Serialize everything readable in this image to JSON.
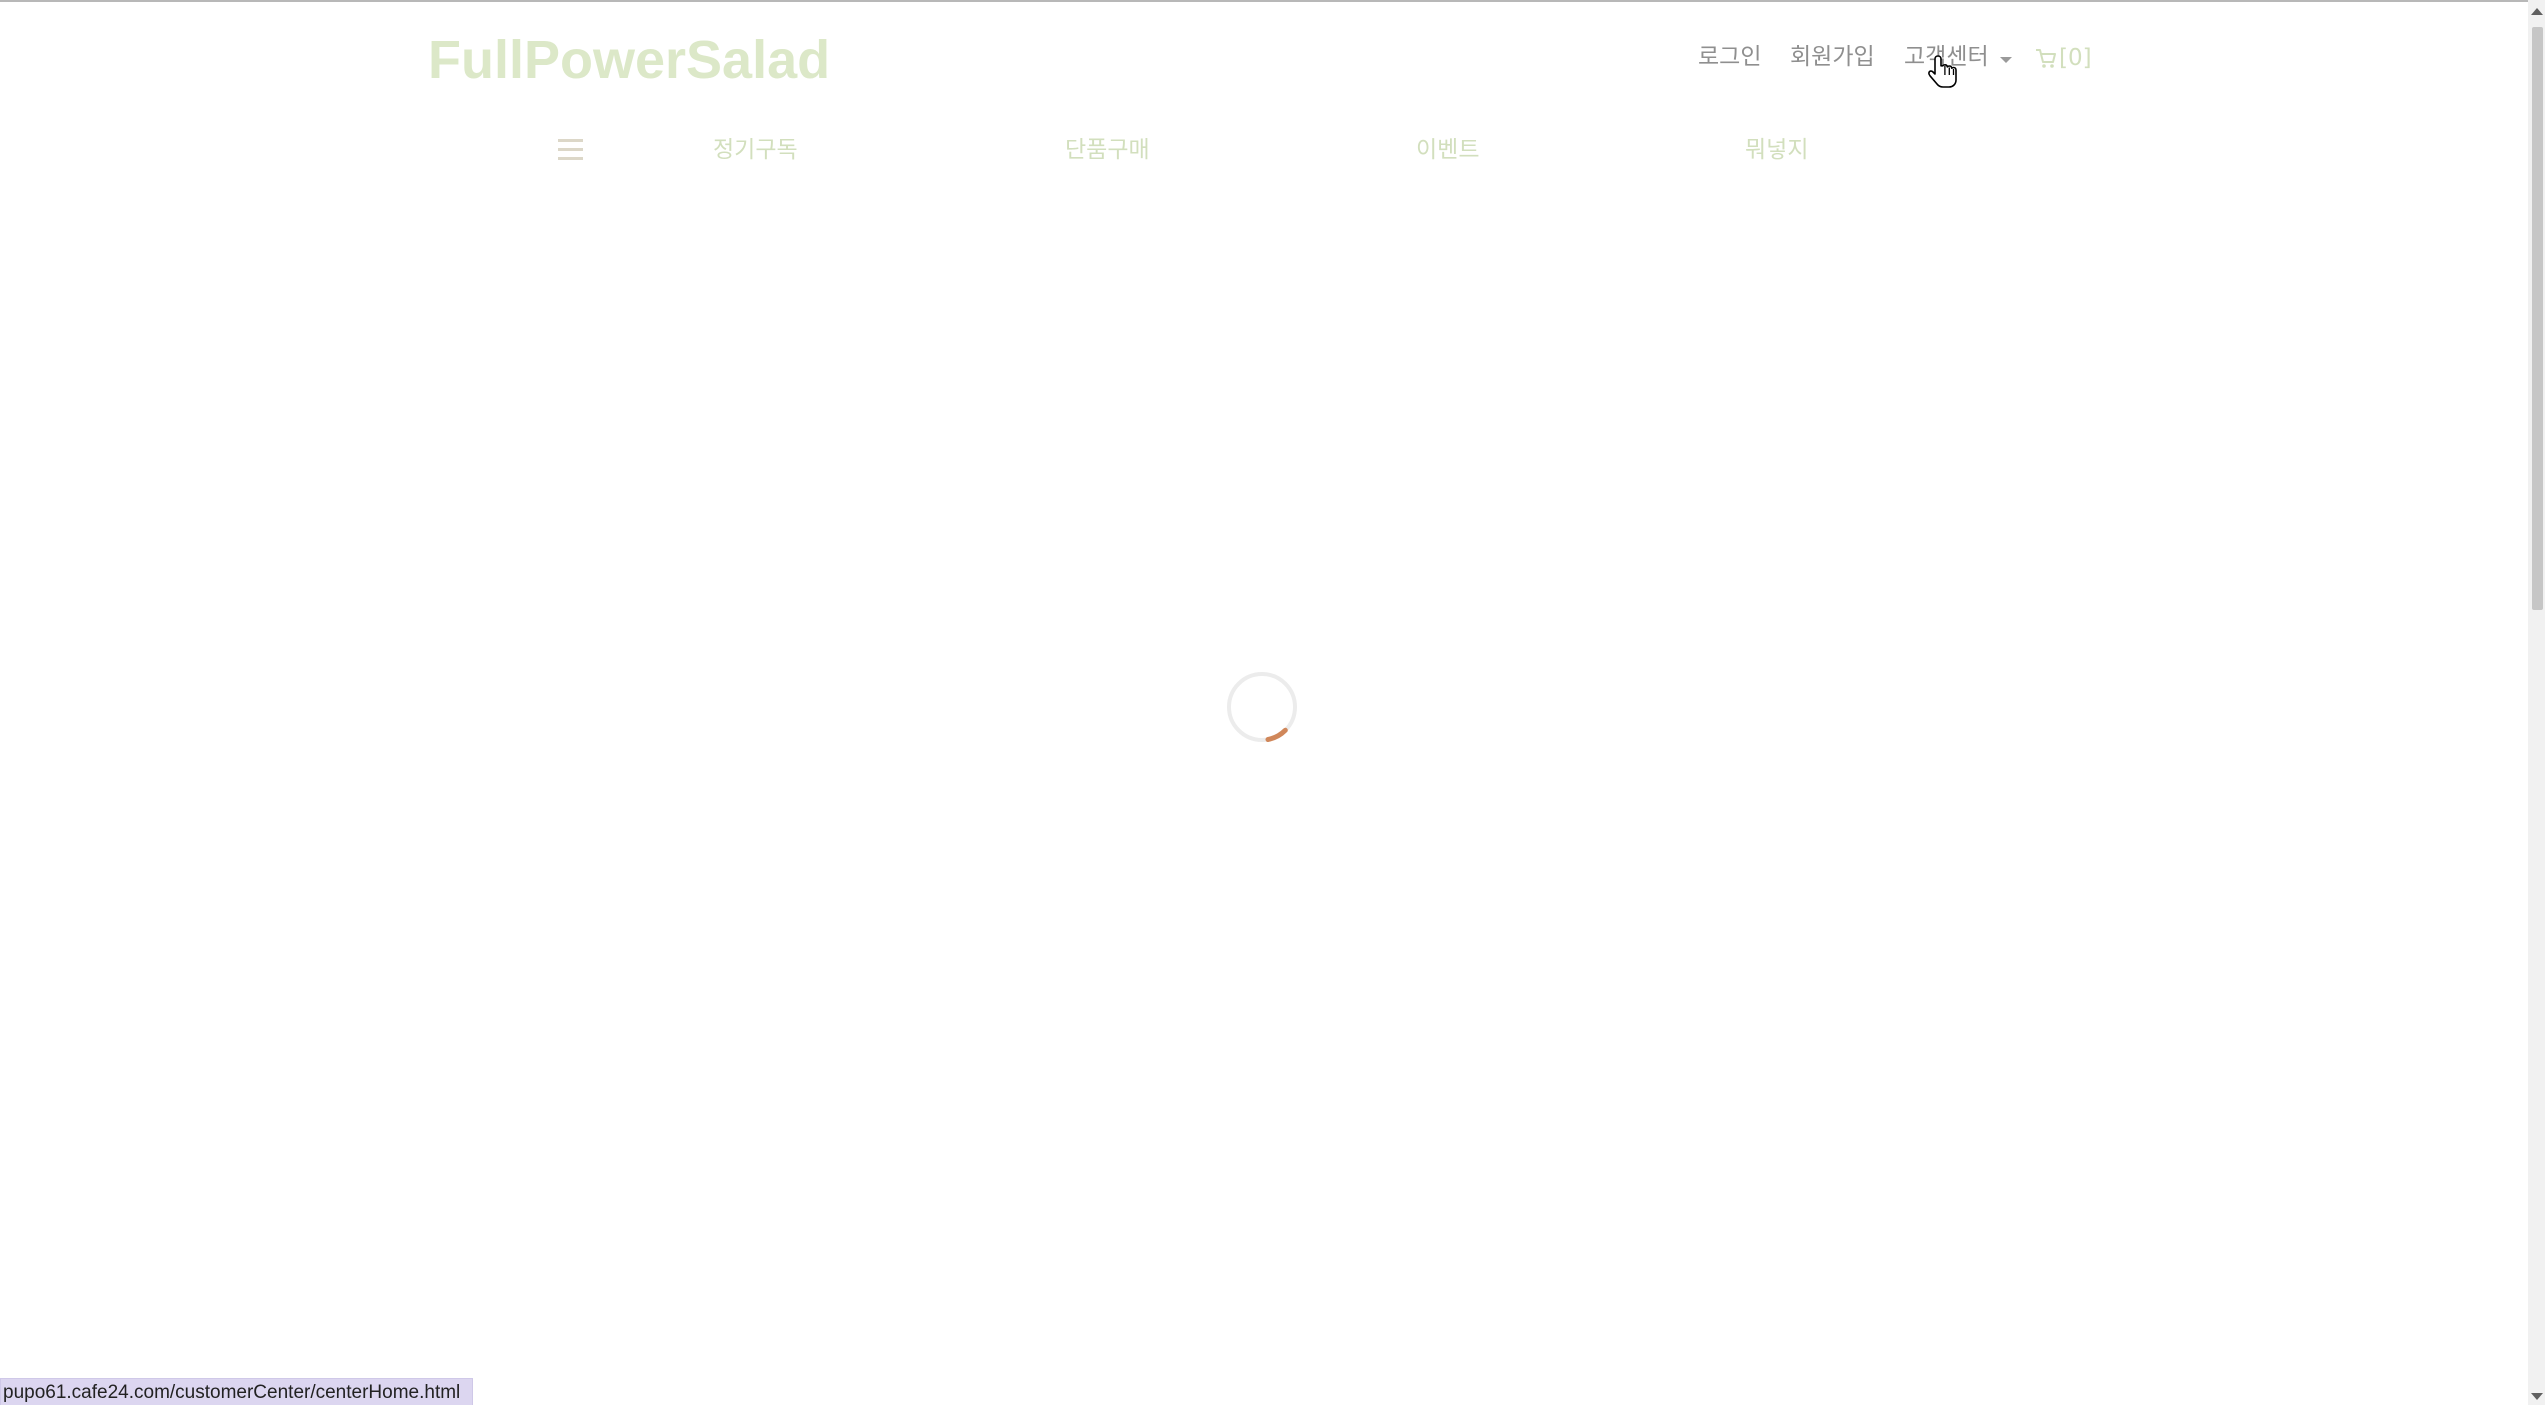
{
  "header": {
    "logo": "FullPowerSalad",
    "login_label": "로그인",
    "signup_label": "회원가입",
    "customer_center_label": "고객센터",
    "cart_label": "[0]"
  },
  "nav": {
    "items": [
      {
        "label": "정기구독"
      },
      {
        "label": "단품구매"
      },
      {
        "label": "이벤트"
      },
      {
        "label": "뭐넣지"
      }
    ]
  },
  "status_bar": {
    "url": "pupo61.cafe24.com/customerCenter/centerHome.html"
  },
  "icons": {
    "menu": "hamburger-menu-icon",
    "cart": "cart-icon",
    "dropdown": "caret-down-icon",
    "loading": "loading-spinner-icon",
    "cursor": "hand-pointer-cursor"
  },
  "colors": {
    "logo": "#dce8c8",
    "nav_text": "#d2dfbd",
    "util_text": "#8f8f8f",
    "spinner_accent": "#d0875a",
    "status_bar_bg": "#dcd6f0"
  }
}
